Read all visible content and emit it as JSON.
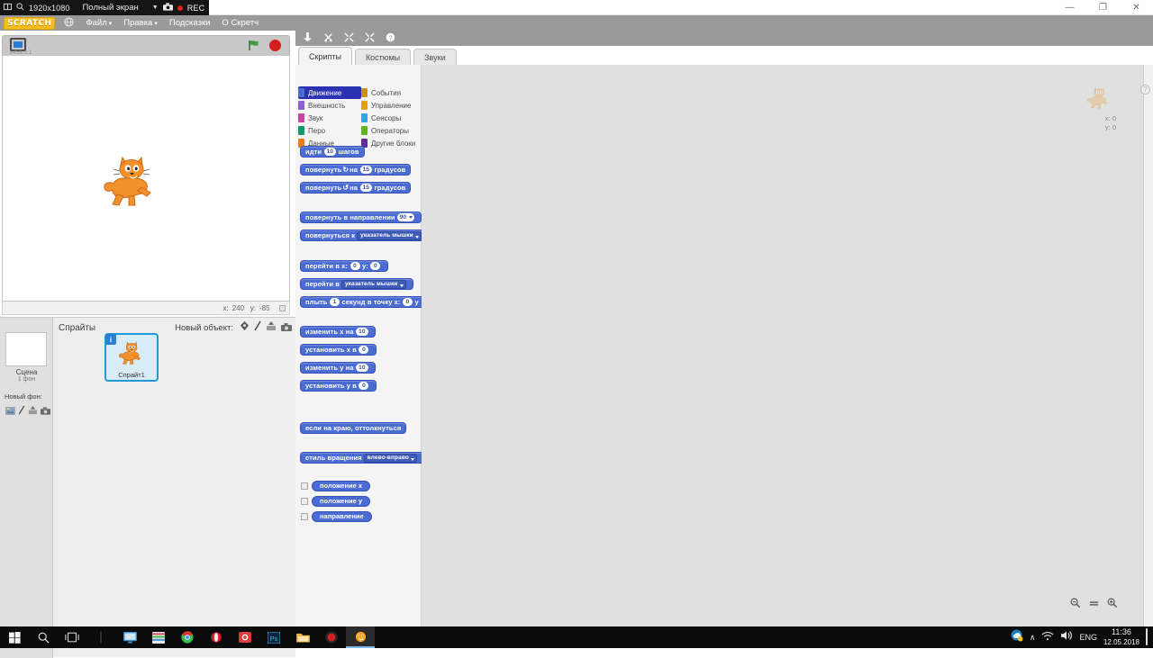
{
  "window": {
    "minimize": "—",
    "maximize": "❐",
    "close": "✕"
  },
  "recorder": {
    "resolution": "1920x1080",
    "mode": "Полный экран",
    "caret": "▼",
    "camera_icon": "camera-icon",
    "rec_label": "REC"
  },
  "menubar": {
    "logo": "SCRATCH",
    "globe_icon": "globe-icon",
    "items": [
      {
        "label": "Файл",
        "caret": "▾"
      },
      {
        "label": "Правка",
        "caret": "▾"
      },
      {
        "label": "Подсказки",
        "caret": ""
      },
      {
        "label": "О Скретч",
        "caret": ""
      }
    ]
  },
  "stage": {
    "version": "v458.0.1",
    "present_icon": "fullscreen-icon",
    "green_flag_icon": "green-flag-icon",
    "stop_icon": "stop-sign-icon",
    "coords": {
      "x_label": "x:",
      "x_value": "240",
      "y_label": "y:",
      "y_value": "-85"
    },
    "sprite_alt": "scratch-cat"
  },
  "sprite_pane": {
    "stage_thumb_name": "Сцена",
    "stage_thumb_sub": "1 фон",
    "new_backdrop_label": "Новый фон:",
    "new_backdrop_icons": [
      "image-icon",
      "paint-icon",
      "upload-icon",
      "camera-icon"
    ],
    "sprites_title": "Спрайты",
    "new_object_label": "Новый объект:",
    "new_object_icons": [
      "paint-icon",
      "brush-icon",
      "upload-icon",
      "camera-icon"
    ],
    "sprites": [
      {
        "name": "Спрайт1",
        "badge": "i",
        "selected": true
      }
    ]
  },
  "toolbar": {
    "icons": [
      "stamp-icon",
      "cut-icon",
      "grow-icon",
      "shrink-icon",
      "help-icon"
    ]
  },
  "tabs": [
    {
      "label": "Скрипты",
      "active": true
    },
    {
      "label": "Костюмы",
      "active": false
    },
    {
      "label": "Звуки",
      "active": false
    }
  ],
  "palette": {
    "categories": [
      {
        "label": "Движение",
        "color": "#4b6cd3",
        "selected": true
      },
      {
        "label": "События",
        "color": "#c59318",
        "selected": false
      },
      {
        "label": "Внешность",
        "color": "#8d5fd3",
        "selected": false
      },
      {
        "label": "Управление",
        "color": "#e2a112",
        "selected": false
      },
      {
        "label": "Звук",
        "color": "#c747a3",
        "selected": false
      },
      {
        "label": "Сенсоры",
        "color": "#2ca5e2",
        "selected": false
      },
      {
        "label": "Перо",
        "color": "#0e9a6c",
        "selected": false
      },
      {
        "label": "Операторы",
        "color": "#5cb712",
        "selected": false
      },
      {
        "label": "Данные",
        "color": "#ee7d16",
        "selected": false
      },
      {
        "label": "Другие блоки",
        "color": "#632d99",
        "selected": false
      }
    ],
    "blocks": [
      {
        "kind": "stack",
        "parts": [
          {
            "t": "text",
            "v": "идти"
          },
          {
            "t": "num",
            "v": "10"
          },
          {
            "t": "text",
            "v": "шагов"
          }
        ]
      },
      {
        "kind": "stack",
        "parts": [
          {
            "t": "text",
            "v": "повернуть"
          },
          {
            "t": "icon",
            "v": "↻"
          },
          {
            "t": "text",
            "v": "на"
          },
          {
            "t": "num",
            "v": "15"
          },
          {
            "t": "text",
            "v": "градусов"
          }
        ]
      },
      {
        "kind": "stack",
        "parts": [
          {
            "t": "text",
            "v": "повернуть"
          },
          {
            "t": "icon",
            "v": "↺"
          },
          {
            "t": "text",
            "v": "на"
          },
          {
            "t": "num",
            "v": "15"
          },
          {
            "t": "text",
            "v": "градусов"
          }
        ]
      },
      {
        "kind": "gap"
      },
      {
        "kind": "stack",
        "parts": [
          {
            "t": "text",
            "v": "повернуть в направлении"
          },
          {
            "t": "numdrop",
            "v": "90"
          }
        ]
      },
      {
        "kind": "stack",
        "parts": [
          {
            "t": "text",
            "v": "повернуться к"
          },
          {
            "t": "drop",
            "v": "указатель мышки"
          }
        ]
      },
      {
        "kind": "gap"
      },
      {
        "kind": "stack",
        "parts": [
          {
            "t": "text",
            "v": "перейти в x:"
          },
          {
            "t": "num",
            "v": "0"
          },
          {
            "t": "text",
            "v": "y:"
          },
          {
            "t": "num",
            "v": "0"
          }
        ]
      },
      {
        "kind": "stack",
        "parts": [
          {
            "t": "text",
            "v": "перейти в"
          },
          {
            "t": "drop",
            "v": "указатель мышки"
          }
        ]
      },
      {
        "kind": "stack",
        "parts": [
          {
            "t": "text",
            "v": "плыть"
          },
          {
            "t": "num",
            "v": "1"
          },
          {
            "t": "text",
            "v": "секунд в точку x:"
          },
          {
            "t": "num",
            "v": "0"
          },
          {
            "t": "text",
            "v": "y"
          }
        ]
      },
      {
        "kind": "gap"
      },
      {
        "kind": "stack",
        "parts": [
          {
            "t": "text",
            "v": "изменить x на"
          },
          {
            "t": "num",
            "v": "10"
          }
        ]
      },
      {
        "kind": "stack",
        "parts": [
          {
            "t": "text",
            "v": "установить x в"
          },
          {
            "t": "num",
            "v": "0"
          }
        ]
      },
      {
        "kind": "stack",
        "parts": [
          {
            "t": "text",
            "v": "изменить y на"
          },
          {
            "t": "num",
            "v": "10"
          }
        ]
      },
      {
        "kind": "stack",
        "parts": [
          {
            "t": "text",
            "v": "установить y в"
          },
          {
            "t": "num",
            "v": "0"
          }
        ]
      },
      {
        "kind": "gap"
      },
      {
        "kind": "gap"
      },
      {
        "kind": "stack",
        "parts": [
          {
            "t": "text",
            "v": "если на краю, оттолкнуться"
          }
        ]
      },
      {
        "kind": "gap"
      },
      {
        "kind": "stack",
        "parts": [
          {
            "t": "text",
            "v": "стиль вращения"
          },
          {
            "t": "drop",
            "v": "влево-вправо"
          }
        ]
      }
    ],
    "reporters": [
      {
        "label": "положение x",
        "checked": false
      },
      {
        "label": "положение y",
        "checked": false
      },
      {
        "label": "направление",
        "checked": false
      }
    ]
  },
  "script_area": {
    "sprite_watermark": "scratch-cat-watermark",
    "x_label": "x:",
    "x_value": "0",
    "y_label": "y:",
    "y_value": "0",
    "help_icon": "question-mark-icon",
    "zoom_out_icon": "zoom-out-icon",
    "zoom_reset_icon": "zoom-reset-icon",
    "zoom_in_icon": "zoom-in-icon"
  },
  "taskbar": {
    "start_icon": "windows-start-icon",
    "search_icon": "search-icon",
    "taskview_icon": "task-view-icon",
    "apps": [
      {
        "name": "monitor-icon",
        "color": "#3f8fd0",
        "active": false
      },
      {
        "name": "files-icon",
        "color": "#d94f4f",
        "active": false
      },
      {
        "name": "chrome-icon",
        "color": "#3cba54",
        "active": false
      },
      {
        "name": "opera-icon",
        "color": "#cc1f2e",
        "active": false
      },
      {
        "name": "camera-app-icon",
        "color": "#e03b3b",
        "active": false
      },
      {
        "name": "photoshop-icon",
        "color": "#1c7fc4",
        "active": false
      },
      {
        "name": "explorer-icon",
        "color": "#f0b83c",
        "active": false
      },
      {
        "name": "recorder-icon",
        "color": "#d02020",
        "active": false
      },
      {
        "name": "scratch-icon",
        "color": "#f5a623",
        "active": true
      }
    ],
    "tray": {
      "overflow_icon": "∧",
      "network_icon": "wifi-icon",
      "volume_icon": "volume-icon",
      "language": "ENG",
      "time": "11:36",
      "date": "12.05.2018",
      "notification_icon": "notification-icon"
    }
  }
}
